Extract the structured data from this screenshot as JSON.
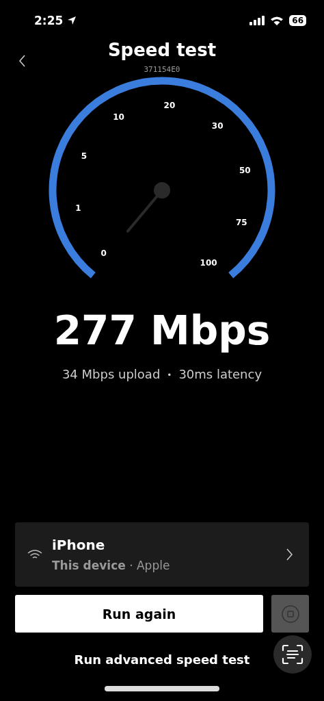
{
  "status_bar": {
    "time": "2:25",
    "battery": "66"
  },
  "header": {
    "title": "Speed test",
    "subtitle": "371154E0"
  },
  "gauge": {
    "ticks": [
      "0",
      "1",
      "5",
      "10",
      "20",
      "30",
      "50",
      "75",
      "100"
    ]
  },
  "result": {
    "speed": "277 Mbps",
    "upload": "34 Mbps upload",
    "separator": "•",
    "latency": "30ms latency"
  },
  "device": {
    "name": "iPhone",
    "detail_bold": "This device",
    "detail": "· Apple"
  },
  "buttons": {
    "run_again": "Run again",
    "advanced": "Run advanced speed test"
  }
}
